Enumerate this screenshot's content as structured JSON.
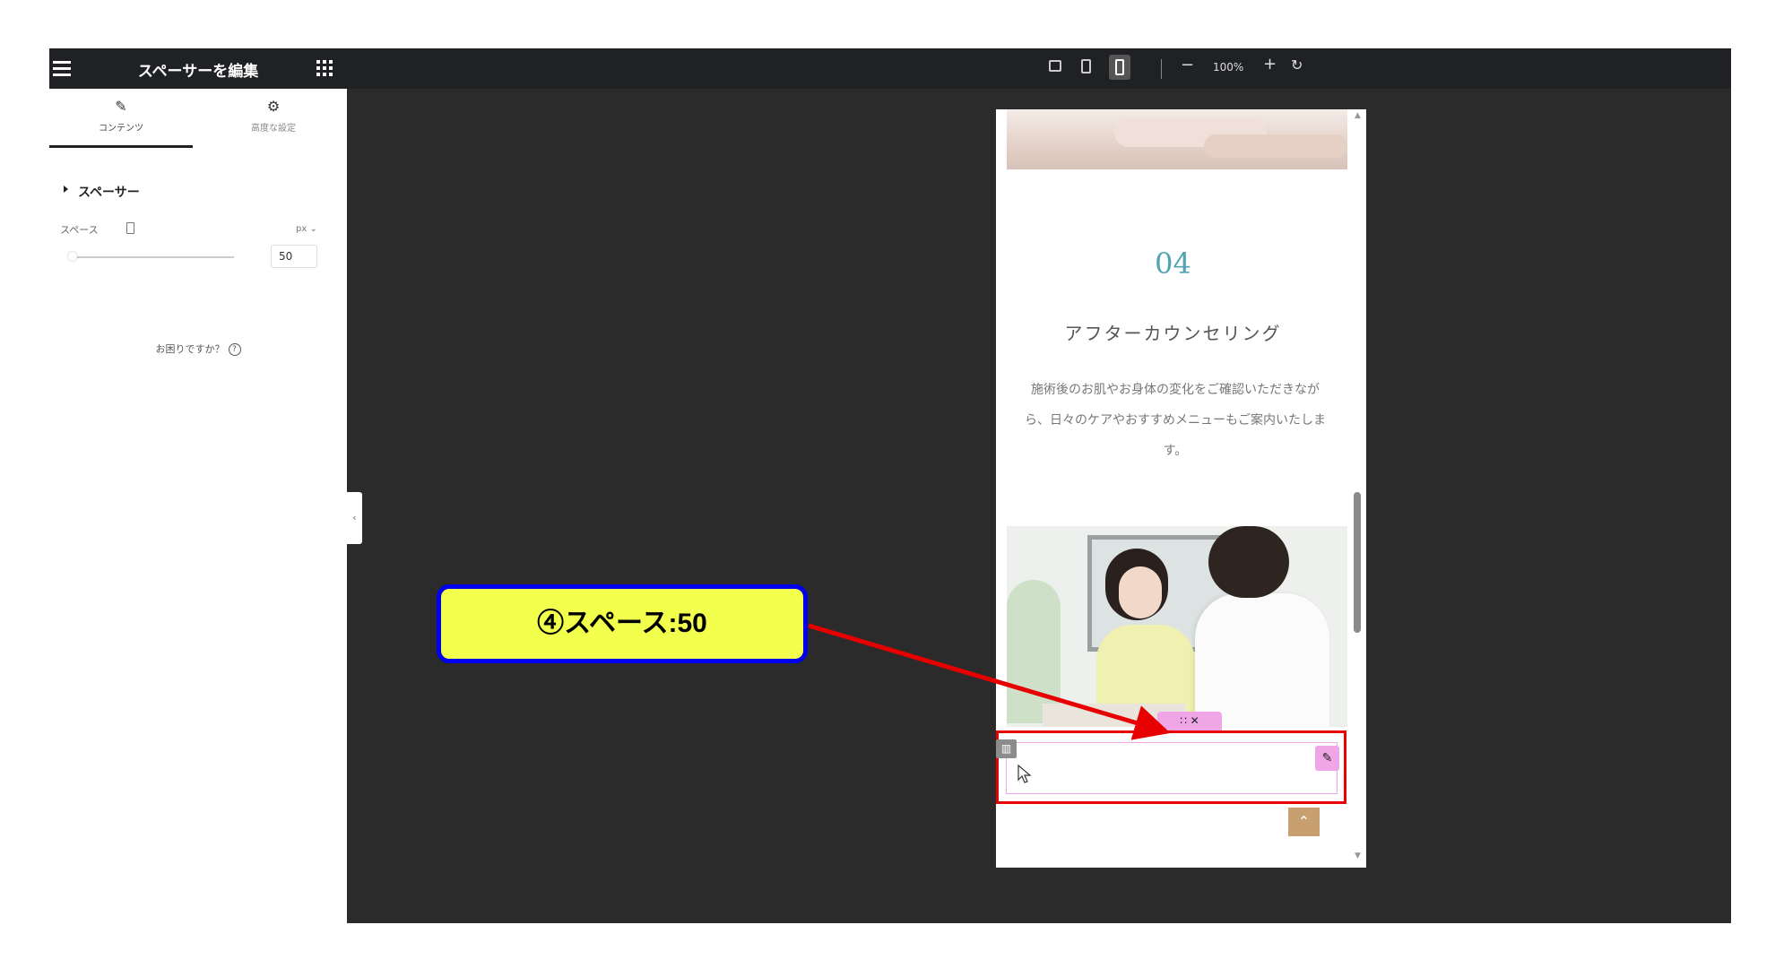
{
  "panel": {
    "title": "スペーサーを編集",
    "tabs": [
      {
        "label": "コンテンツ",
        "icon": "pencil-icon"
      },
      {
        "label": "高度な設定",
        "icon": "gear-icon"
      }
    ],
    "section_title": "スペーサー",
    "space_label": "スペース",
    "unit": "px ⌄",
    "space_value": "50",
    "help_text": "お困りですか？",
    "help_icon_glyph": "?"
  },
  "toolbar": {
    "zoom_out": "−",
    "zoom_level": "100%",
    "zoom_in": "+",
    "reset": "↻"
  },
  "preview": {
    "step_number": "04",
    "step_title": "アフターカウンセリング",
    "step_desc": "施術後のお肌やお身体の変化をご確認いただきながら、日々のケアやおすすめメニューもご案内いたします。",
    "widget_handle": "∷  ✕",
    "back_to_top": "⌃"
  },
  "annotation": {
    "callout_text": "④スペース:50",
    "arrow_color": "#e60000",
    "callout_bg": "#f2ff4c",
    "callout_border": "#0000ee"
  },
  "colors": {
    "panel_header": "#1f2124",
    "canvas": "#2b2b2b",
    "accent_number": "#4fa3b3",
    "handle_pink": "#f0a6e6",
    "back_to_top": "#c8a06f"
  }
}
